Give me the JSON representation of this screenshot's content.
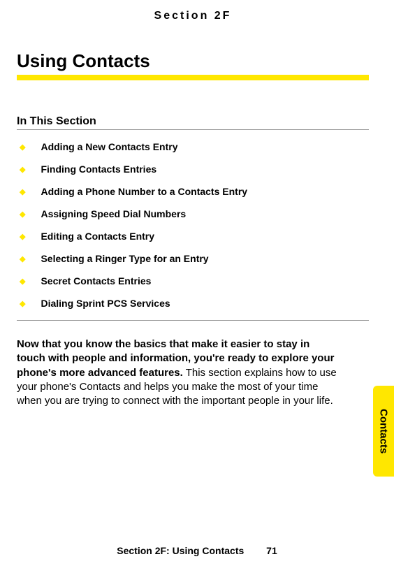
{
  "header": {
    "section_label": "Section 2F"
  },
  "chapter": {
    "title": "Using Contacts"
  },
  "in_this_section": {
    "heading": "In This Section",
    "items": [
      "Adding a New Contacts Entry",
      "Finding Contacts Entries",
      "Adding a Phone Number to a Contacts Entry",
      "Assigning Speed Dial Numbers",
      "Editing a Contacts Entry",
      "Selecting a Ringer Type for an Entry",
      "Secret Contacts Entries",
      "Dialing Sprint PCS Services"
    ]
  },
  "body": {
    "lead_bold": "Now that you know the basics that make it easier to stay in touch with people and information, you're ready to explore your phone's more advanced features.",
    "rest": " This section explains how to use your phone's Contacts and helps you make the most of your time when you are trying to connect with the important people in your life."
  },
  "side_tab": {
    "label": "Contacts"
  },
  "footer": {
    "title": "Section 2F: Using Contacts",
    "page": "71"
  }
}
